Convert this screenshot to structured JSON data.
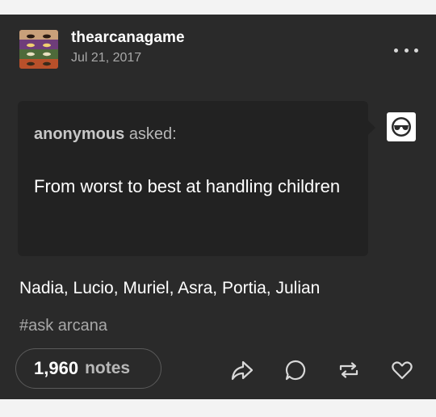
{
  "post": {
    "blog_name": "thearcanagame",
    "date": "Jul 21, 2017",
    "avatar_icon": "blog-avatar-icon",
    "more_icon": "more-options-icon"
  },
  "ask": {
    "asker": "anonymous",
    "asked_text": "asked:",
    "question": "From worst to best at handling children",
    "asker_avatar_icon": "anonymous-avatar-icon"
  },
  "answer": {
    "text": "Nadia, Lucio, Muriel, Asra, Portia, Julian",
    "tag": "#ask arcana"
  },
  "footer": {
    "notes_count": "1,960",
    "notes_label": "notes",
    "actions": [
      "share-icon",
      "reply-icon",
      "reblog-icon",
      "like-icon"
    ]
  },
  "colors": {
    "post_background": "#2a2a2a",
    "ask_background": "#222222",
    "page_background": "#f3f3f3",
    "muted_text": "#a8a8a8"
  }
}
